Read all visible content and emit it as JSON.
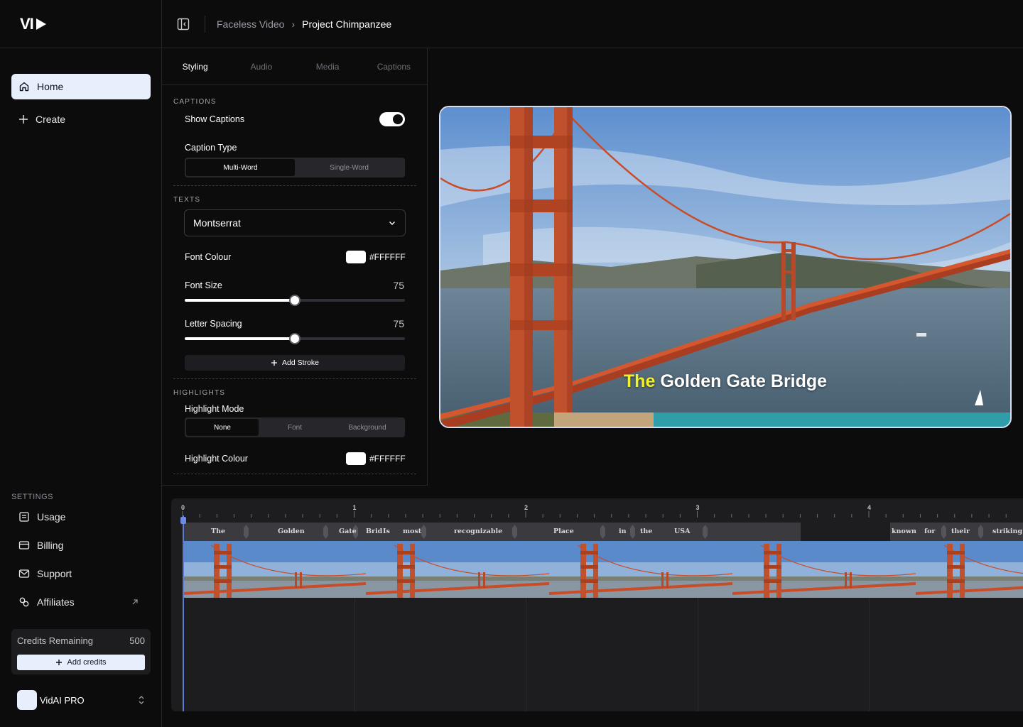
{
  "logo": {
    "text": "VI"
  },
  "sidebar": {
    "items": [
      {
        "label": "Home",
        "icon": "home-icon",
        "active": true
      },
      {
        "label": "Create",
        "icon": "plus-icon",
        "active": false
      }
    ],
    "settings_label": "SETTINGS",
    "settings_items": [
      {
        "label": "Usage",
        "icon": "usage-icon"
      },
      {
        "label": "Billing",
        "icon": "card-icon"
      },
      {
        "label": "Support",
        "icon": "mail-icon"
      },
      {
        "label": "Affiliates",
        "icon": "affiliates-icon",
        "external": true
      }
    ],
    "credits": {
      "label": "Credits Remaining",
      "value": "500",
      "button": "Add credits"
    },
    "account": {
      "name": "VidAI PRO"
    }
  },
  "header": {
    "breadcrumb": [
      "Faceless Video",
      "Project Chimpanzee"
    ]
  },
  "panel": {
    "tabs": [
      "Styling",
      "Audio",
      "Media",
      "Captions"
    ],
    "active_tab": "Styling",
    "captions": {
      "section_label": "CAPTIONS",
      "show_captions_label": "Show Captions",
      "show_captions": true,
      "caption_type_label": "Caption Type",
      "caption_type_options": [
        "Multi-Word",
        "Single-Word"
      ],
      "caption_type_selected": "Multi-Word"
    },
    "texts": {
      "section_label": "TEXTS",
      "font": "Montserrat",
      "font_colour_label": "Font Colour",
      "font_colour": "#FFFFFF",
      "font_size_label": "Font Size",
      "font_size": "75",
      "font_size_fraction": 0.5,
      "letter_spacing_label": "Letter Spacing",
      "letter_spacing": "75",
      "letter_spacing_fraction": 0.5,
      "add_stroke": "Add Stroke"
    },
    "highlights": {
      "section_label": "HIGHLIGHTS",
      "mode_label": "Highlight Mode",
      "mode_options": [
        "None",
        "Font",
        "Background"
      ],
      "mode_selected": "None",
      "colour_label": "Highlight Colour",
      "colour": "#FFFFFF"
    }
  },
  "preview": {
    "caption_highlight": "The",
    "caption_rest": "Golden Gate Bridge",
    "highlight_color": "#f0f12a"
  },
  "timeline": {
    "seconds": [
      "0",
      "1",
      "2",
      "3",
      "4"
    ],
    "words": [
      "The",
      "Golden",
      "Gate",
      "Brid",
      "Is",
      "most",
      "recognizable",
      "Place",
      "in",
      "the",
      "USA",
      "known",
      "for",
      "their",
      "striking"
    ],
    "playhead_seconds": 0
  }
}
